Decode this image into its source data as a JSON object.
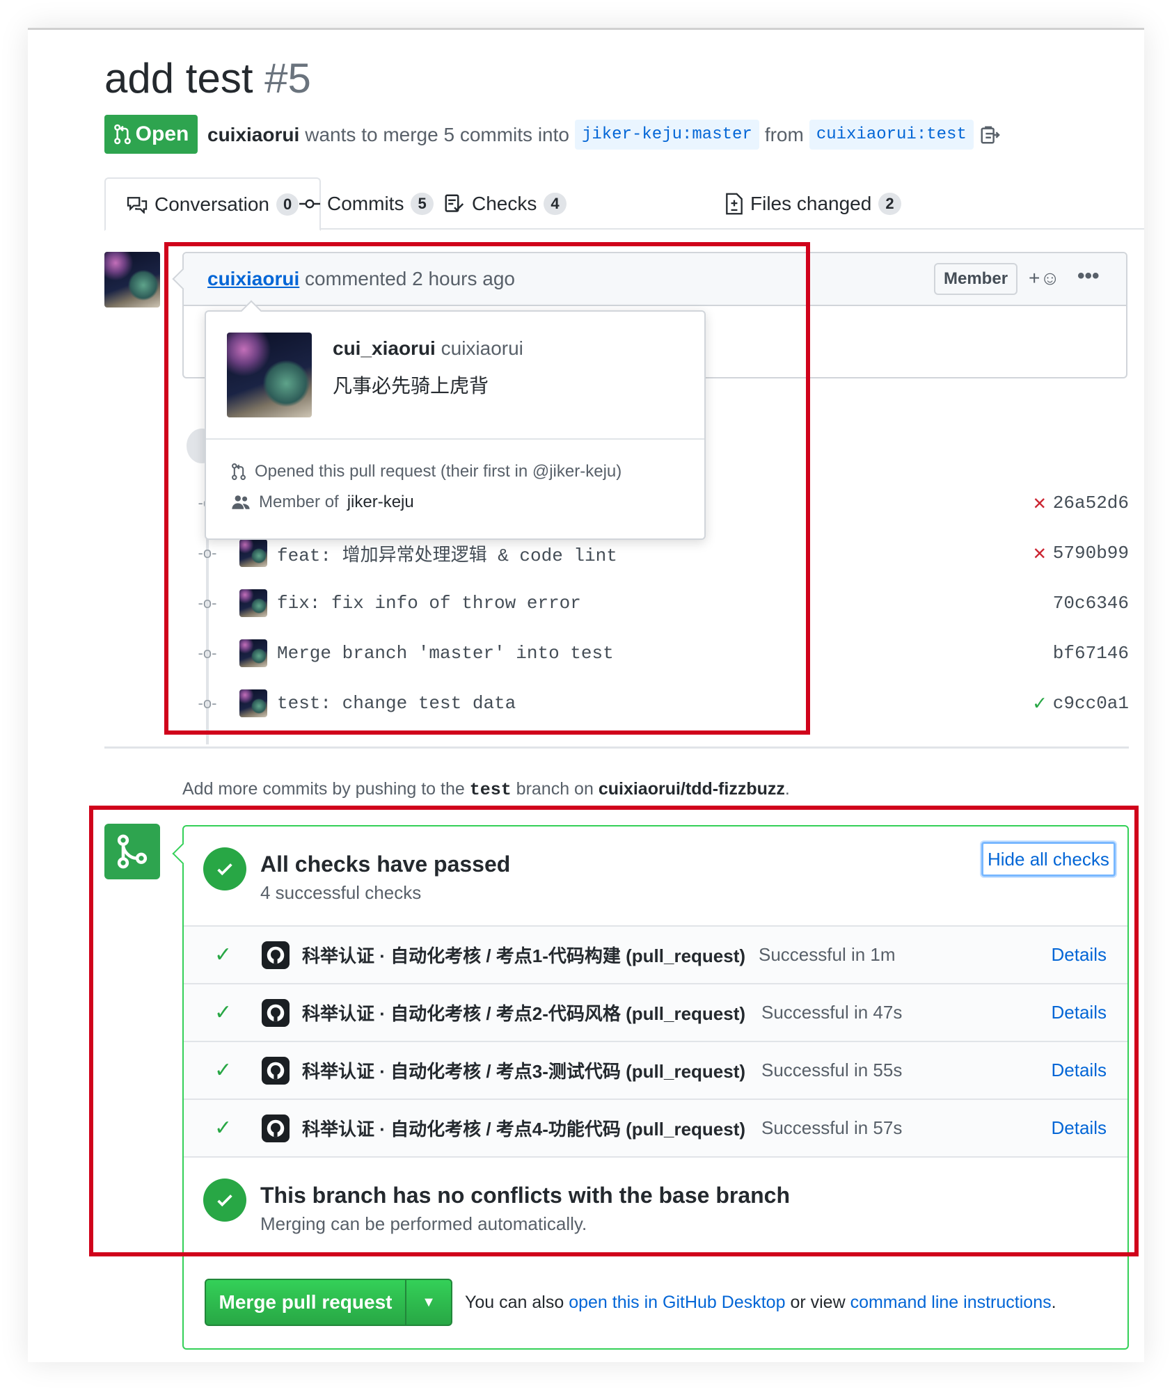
{
  "pr": {
    "title": "add test",
    "number": "#5",
    "state": "Open",
    "author": "cuixiaorui",
    "merge_text_1": "wants to merge 5 commits into",
    "base_branch": "jiker-keju:master",
    "from_text": "from",
    "head_branch": "cuixiaorui:test"
  },
  "tabs": [
    {
      "label": "Conversation",
      "count": "0"
    },
    {
      "label": "Commits",
      "count": "5"
    },
    {
      "label": "Checks",
      "count": "4"
    },
    {
      "label": "Files changed",
      "count": "2"
    }
  ],
  "comment": {
    "author": "cuixiaorui",
    "action": "commented 2 hours ago",
    "role_badge": "Member",
    "react_label": "+☺",
    "more_label": "•••"
  },
  "hovercard": {
    "display_name": "cui_xiaorui",
    "login": "cuixiaorui",
    "bio": "凡事必先骑上虎背",
    "opened_text": "Opened this pull request (their first in @jiker-keju)",
    "member_prefix": "Member of",
    "member_org": "jiker-keju"
  },
  "commits": [
    {
      "message": "",
      "sha": "26a52d6",
      "status": "fail"
    },
    {
      "message": "feat: 增加异常处理逻辑 & code lint",
      "sha": "5790b99",
      "status": "fail"
    },
    {
      "message": "fix: fix info of throw error",
      "sha": "70c6346",
      "status": "none"
    },
    {
      "message": "Merge branch 'master' into test",
      "sha": "bf67146",
      "status": "none"
    },
    {
      "message": "test: change test data",
      "sha": "c9cc0a1",
      "status": "ok"
    }
  ],
  "push_hint": {
    "prefix": "Add more commits by pushing to the",
    "branch": "test",
    "middle": "branch on",
    "repo": "cuixiaorui/tdd-fizzbuzz",
    "suffix": "."
  },
  "checks": {
    "title": "All checks have passed",
    "subtitle": "4 successful checks",
    "hide_label": "Hide all checks",
    "items": [
      {
        "name": "科举认证 · 自动化考核 / 考点1-代码构建 (pull_request)",
        "duration": "Successful in 1m",
        "details": "Details"
      },
      {
        "name": "科举认证 · 自动化考核 / 考点2-代码风格 (pull_request)",
        "duration": "Successful in 47s",
        "details": "Details"
      },
      {
        "name": "科举认证 · 自动化考核 / 考点3-测试代码 (pull_request)",
        "duration": "Successful in 55s",
        "details": "Details"
      },
      {
        "name": "科举认证 · 自动化考核 / 考点4-功能代码 (pull_request)",
        "duration": "Successful in 57s",
        "details": "Details"
      }
    ]
  },
  "conflicts": {
    "title": "This branch has no conflicts with the base branch",
    "subtitle": "Merging can be performed automatically."
  },
  "merge": {
    "button_label": "Merge pull request",
    "alt_prefix": "You can also",
    "desktop_link": "open this in GitHub Desktop",
    "alt_middle": "or view",
    "cli_link": "command line instructions",
    "alt_suffix": "."
  },
  "colors": {
    "open_green": "#2ea44f",
    "link_blue": "#0366d6",
    "fail_red": "#cb2431",
    "annotation_red": "#d0021b"
  }
}
